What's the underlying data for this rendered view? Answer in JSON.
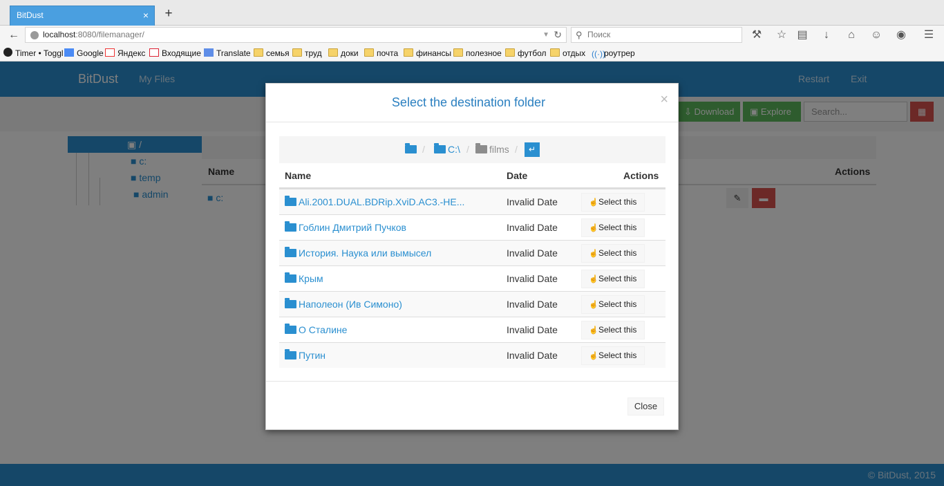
{
  "browser": {
    "tab_title": "BitDust",
    "tab_close": "×",
    "new_tab": "+",
    "url_host": "localhost",
    "url_rest": ":8080/filemanager/",
    "search_placeholder": "Поиск",
    "bookmarks": [
      "Timer • Toggl",
      "Google",
      "Яндекс",
      "Входящие",
      "Translate",
      "семья",
      "труд",
      "доки",
      "почта",
      "финансы",
      "полезное",
      "футбол",
      "отдых",
      "роутрер"
    ]
  },
  "app": {
    "brand": "BitDust",
    "nav_my_files": "My Files",
    "nav_restart": "Restart",
    "nav_exit": "Exit",
    "download_label": "Download",
    "explore_label": "Explore",
    "search_placeholder": "Search...",
    "tree": {
      "root": "/",
      "n1": "c:",
      "n2": "temp",
      "n3": "admin"
    },
    "table": {
      "col_name": "Name",
      "col_actions": "Actions",
      "row1": "c:"
    },
    "footer": "© BitDust, 2015"
  },
  "modal": {
    "title": "Select the destination folder",
    "close_x": "×",
    "crumbs": {
      "sep": "/",
      "drive": "C:\\",
      "folder": "films"
    },
    "enter": "↵",
    "col_name": "Name",
    "col_date": "Date",
    "col_actions": "Actions",
    "select_label": "Select this",
    "rows": [
      {
        "name": "Ali.2001.DUAL.BDRip.XviD.AC3.-HE...",
        "date": "Invalid Date"
      },
      {
        "name": "Гоблин Дмитрий Пучков",
        "date": "Invalid Date"
      },
      {
        "name": "История. Наука или вымысел",
        "date": "Invalid Date"
      },
      {
        "name": "Крым",
        "date": "Invalid Date"
      },
      {
        "name": "Наполеон (Ив Симоно)",
        "date": "Invalid Date"
      },
      {
        "name": "О Сталине",
        "date": "Invalid Date"
      },
      {
        "name": "Путин",
        "date": "Invalid Date"
      }
    ],
    "close_label": "Close"
  }
}
